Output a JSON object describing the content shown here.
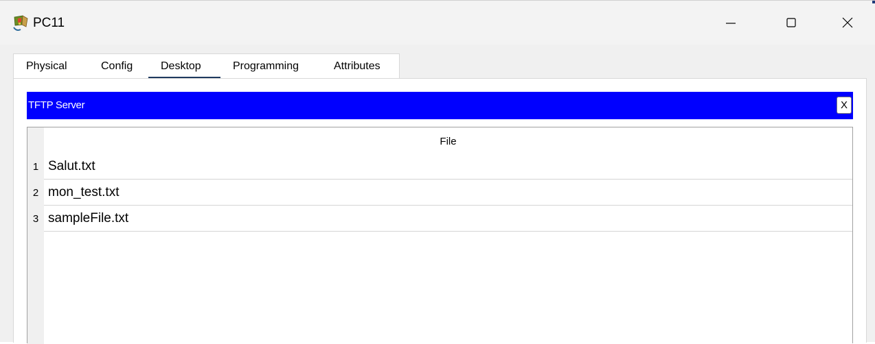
{
  "window": {
    "title": "PC11",
    "controls": {
      "minimize_icon": "minimize-icon",
      "maximize_icon": "maximize-icon",
      "close_icon": "close-icon"
    }
  },
  "tabs": [
    {
      "label": "Physical",
      "active": false
    },
    {
      "label": "Config",
      "active": false
    },
    {
      "label": "Desktop",
      "active": true
    },
    {
      "label": "Programming",
      "active": false
    },
    {
      "label": "Attributes",
      "active": false
    }
  ],
  "app": {
    "title": "TFTP Server",
    "close_label": "X",
    "title_bg": "#0000ff"
  },
  "table": {
    "column_header": "File",
    "rows": [
      {
        "num": "1",
        "file": "Salut.txt"
      },
      {
        "num": "2",
        "file": "mon_test.txt"
      },
      {
        "num": "3",
        "file": "sampleFile.txt"
      }
    ]
  },
  "colors": {
    "accent_underline": "#1e3a5f",
    "app_title_bar": "#0000ff"
  }
}
